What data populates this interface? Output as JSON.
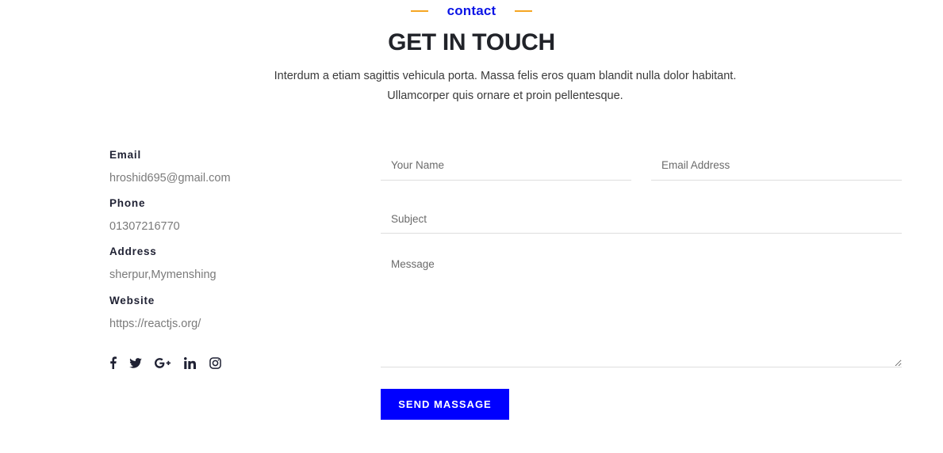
{
  "section": {
    "eyebrow": "contact",
    "title": "GET IN TOUCH",
    "subtitle_line1": "Interdum a etiam sagittis vehicula porta. Massa felis eros quam blandit nulla dolor habitant.",
    "subtitle_line2": "Ullamcorper quis ornare et proin pellentesque."
  },
  "info": {
    "email": {
      "label": "Email",
      "value": "hroshid695@gmail.com"
    },
    "phone": {
      "label": "Phone",
      "value": "01307216770"
    },
    "address": {
      "label": "Address",
      "value": "sherpur,Mymenshing"
    },
    "website": {
      "label": "Website",
      "value": "https://reactjs.org/"
    }
  },
  "socials": [
    {
      "icon": "facebook-icon"
    },
    {
      "icon": "twitter-icon"
    },
    {
      "icon": "google-plus-icon"
    },
    {
      "icon": "linkedin-icon"
    },
    {
      "icon": "instagram-icon"
    }
  ],
  "form": {
    "name_placeholder": "Your Name",
    "email_placeholder": "Email Address",
    "subject_placeholder": "Subject",
    "message_placeholder": "Message",
    "submit_label": "SEND MASSAGE"
  },
  "colors": {
    "accent": "#0000ff",
    "eyebrow_dash": "#f5a623",
    "heading": "#212329"
  }
}
